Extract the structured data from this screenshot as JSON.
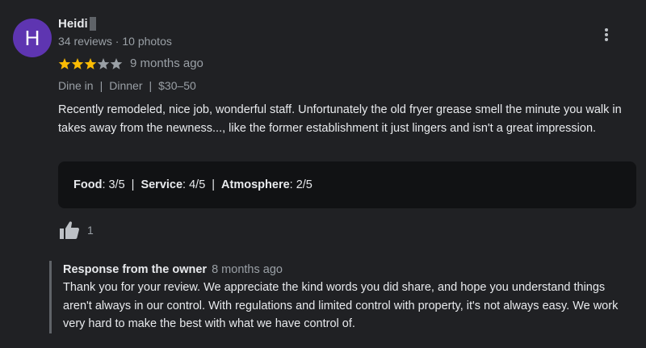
{
  "reviewer": {
    "avatar_letter": "H",
    "avatar_color": "#5e35b1",
    "name": "Heidi",
    "stats": "34 reviews · 10 photos"
  },
  "more_options_icon": "more-vertical-icon",
  "rating": {
    "stars": 3,
    "max_stars": 5,
    "star_color": "#fbbc04",
    "time_ago": "9 months ago"
  },
  "tags": [
    "Dine in",
    "Dinner",
    "$30–50"
  ],
  "tag_separator": "|",
  "review_text": "Recently remodeled, nice job, wonderful staff. Unfortunately the old fryer grease smell the minute you walk in takes away from the newness..., like the former establishment it just lingers and isn't a great impression.",
  "subratings": [
    {
      "label": "Food",
      "value": ": 3/5"
    },
    {
      "label": "Service",
      "value": ": 4/5"
    },
    {
      "label": "Atmosphere",
      "value": ": 2/5"
    }
  ],
  "likes": {
    "icon": "thumbs-up-icon",
    "count": "1"
  },
  "owner_response": {
    "title": "Response from the owner",
    "time_ago": "8 months ago",
    "text": "Thank you for your review. We appreciate the kind words you did share, and hope you understand things aren't always in our control. With regulations and limited control with property, it's not always easy. We work very hard to make the best with what we have control of."
  }
}
